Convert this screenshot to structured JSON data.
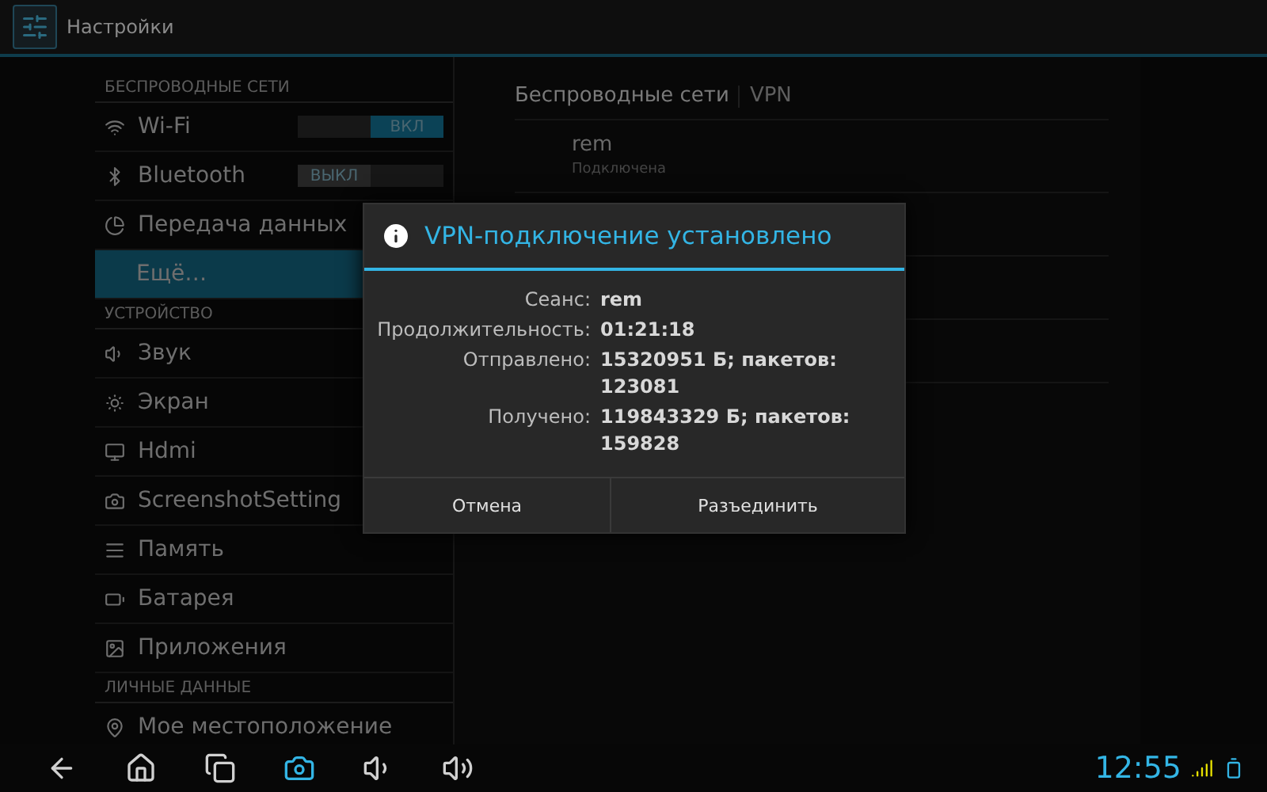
{
  "action_bar": {
    "title": "Настройки"
  },
  "sidebar": {
    "sections": [
      {
        "header": "БЕСПРОВОДНЫЕ СЕТИ",
        "items": [
          {
            "label": "Wi-Fi",
            "kind": "toggle",
            "selected": false,
            "on": true,
            "toggle_label": "ВКЛ"
          },
          {
            "label": "Bluetooth",
            "kind": "toggle",
            "selected": false,
            "on": false,
            "toggle_label": "ВЫКЛ"
          },
          {
            "label": "Передача данных",
            "kind": "plain",
            "selected": false
          },
          {
            "label": "Ещё…",
            "kind": "plain",
            "selected": true
          }
        ]
      },
      {
        "header": "УСТРОЙСТВО",
        "items": [
          {
            "label": "Звук",
            "kind": "plain",
            "selected": false
          },
          {
            "label": "Экран",
            "kind": "plain",
            "selected": false
          },
          {
            "label": "Hdmi",
            "kind": "plain",
            "selected": false
          },
          {
            "label": "ScreenshotSetting",
            "kind": "plain",
            "selected": false
          },
          {
            "label": "Память",
            "kind": "plain",
            "selected": false
          },
          {
            "label": "Батарея",
            "kind": "plain",
            "selected": false
          },
          {
            "label": "Приложения",
            "kind": "plain",
            "selected": false
          }
        ]
      },
      {
        "header": "ЛИЧНЫЕ ДАННЫЕ",
        "items": [
          {
            "label": "Мое местоположение",
            "kind": "plain",
            "selected": false
          }
        ]
      }
    ]
  },
  "detail": {
    "breadcrumb": [
      "Беспроводные сети",
      "VPN"
    ],
    "vpn_list": [
      {
        "name": "rem",
        "status": "Подключена"
      }
    ]
  },
  "dialog": {
    "title": "VPN-подключение установлено",
    "rows": [
      {
        "label": "Сеанс:",
        "value": "rem"
      },
      {
        "label": "Продолжительность:",
        "value": "01:21:18"
      },
      {
        "label": "Отправлено:",
        "value": "15320951 Б; пакетов: 123081"
      },
      {
        "label": "Получено:",
        "value": "119843329 Б; пакетов: 159828"
      }
    ],
    "buttons": [
      "Отмена",
      "Разъединить"
    ]
  },
  "status_bar": {
    "time": "12:55"
  }
}
